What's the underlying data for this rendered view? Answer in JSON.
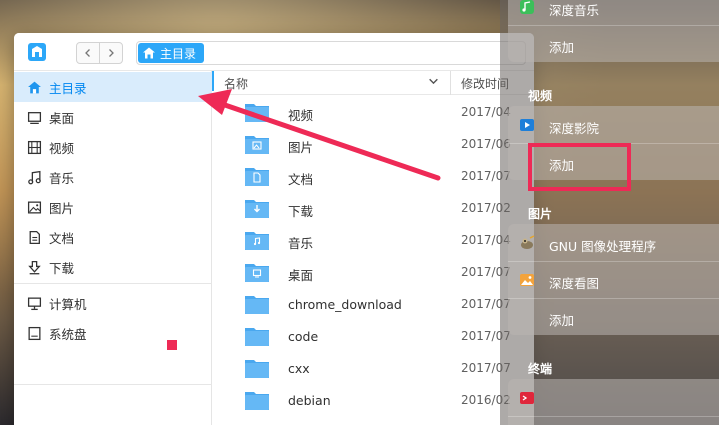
{
  "file_manager": {
    "breadcrumb": {
      "current": "主目录"
    },
    "sidebar": {
      "items": [
        {
          "label": "主目录",
          "icon": "home-icon",
          "active": true
        },
        {
          "label": "桌面",
          "icon": "desktop-icon"
        },
        {
          "label": "视频",
          "icon": "film-icon"
        },
        {
          "label": "音乐",
          "icon": "music-icon"
        },
        {
          "label": "图片",
          "icon": "picture-icon"
        },
        {
          "label": "文档",
          "icon": "document-icon"
        },
        {
          "label": "下载",
          "icon": "download-icon"
        },
        {
          "label": "计算机",
          "icon": "computer-icon"
        },
        {
          "label": "系统盘",
          "icon": "disk-icon"
        }
      ]
    },
    "list": {
      "columns": {
        "name": "名称",
        "modified": "修改时间"
      },
      "rows": [
        {
          "name": "视频",
          "date": "2017/04",
          "badge": "none"
        },
        {
          "name": "图片",
          "date": "2017/06",
          "badge": "picture"
        },
        {
          "name": "文档",
          "date": "2017/07",
          "badge": "document"
        },
        {
          "name": "下载",
          "date": "2017/02",
          "badge": "download"
        },
        {
          "name": "音乐",
          "date": "2017/04",
          "badge": "music"
        },
        {
          "name": "桌面",
          "date": "2017/07",
          "badge": "desktop"
        },
        {
          "name": "chrome_download",
          "date": "2017/07",
          "badge": "none"
        },
        {
          "name": "code",
          "date": "2017/07",
          "badge": "none"
        },
        {
          "name": "cxx",
          "date": "2017/07",
          "badge": "none"
        },
        {
          "name": "debian",
          "date": "2016/02",
          "badge": "none"
        }
      ]
    }
  },
  "launcher": {
    "music_app": "深度音乐",
    "add_label": "添加",
    "video": {
      "title": "视频",
      "app": "深度影院"
    },
    "picture": {
      "title": "图片",
      "apps": [
        "GNU 图像处理程序",
        "深度看图"
      ]
    },
    "terminal": {
      "title": "终端"
    }
  },
  "colors": {
    "accent": "#2ca7f8",
    "annotation": "#ee2a56",
    "folder": "#65b8f5"
  }
}
